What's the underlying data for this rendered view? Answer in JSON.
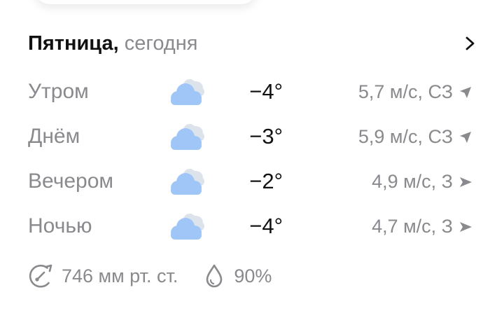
{
  "header": {
    "day": "Пятница,",
    "when": "сегодня"
  },
  "rows": [
    {
      "part": "Утром",
      "temp": "−4°",
      "wind": "5,7 м/с, СЗ",
      "wind_dir": "northwest",
      "icon": "cloudy-icon"
    },
    {
      "part": "Днём",
      "temp": "−3°",
      "wind": "5,9 м/с, СЗ",
      "wind_dir": "northwest",
      "icon": "cloudy-icon"
    },
    {
      "part": "Вечером",
      "temp": "−2°",
      "wind": "4,9 м/с, З",
      "wind_dir": "west",
      "icon": "cloudy-icon"
    },
    {
      "part": "Ночью",
      "temp": "−4°",
      "wind": "4,7 м/с, З",
      "wind_dir": "west",
      "icon": "cloudy-icon"
    }
  ],
  "footer": {
    "pressure": "746 мм рт. ст.",
    "humidity": "90%"
  },
  "colors": {
    "cloud_front": "#9fc6f7",
    "cloud_back": "#dde3ea",
    "muted_text": "#8a8a8e",
    "main_text": "#111111"
  }
}
